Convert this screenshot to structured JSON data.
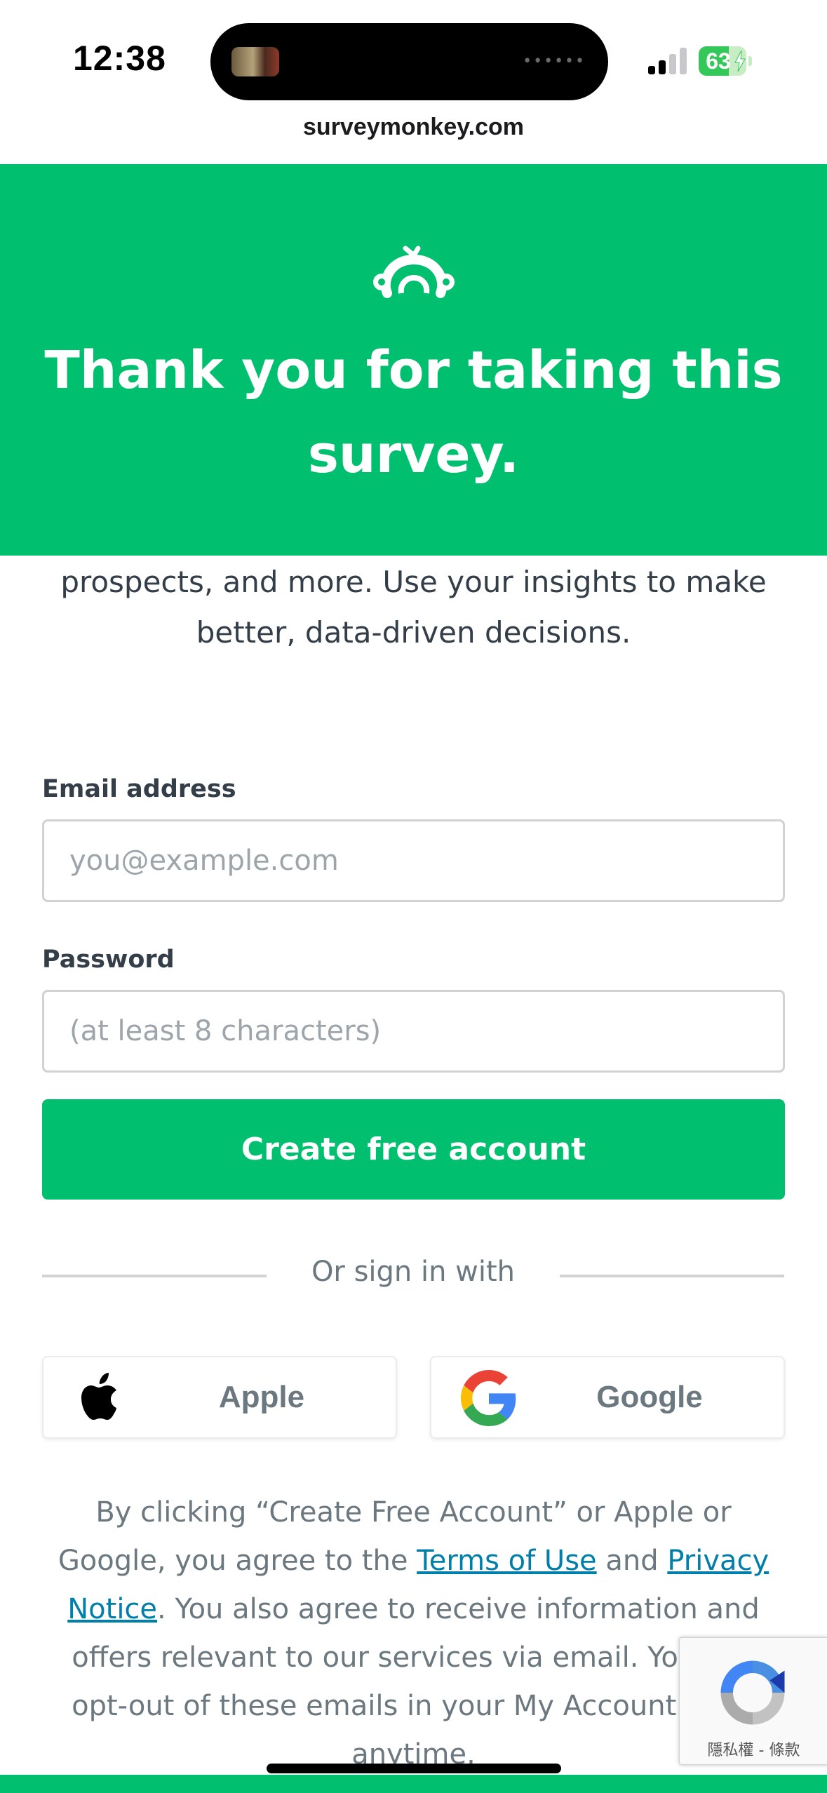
{
  "status_bar": {
    "time": "12:38",
    "battery_percent": "63",
    "battery_level": 0.63,
    "signal_bars_active": 2,
    "signal_bars_total": 4
  },
  "browser": {
    "url": "surveymonkey.com"
  },
  "hero": {
    "title": "Thank you for taking this survey.",
    "background_color": "#00bf6f"
  },
  "intro": {
    "text": "prospects, and more. Use your insights to make better, data-driven decisions."
  },
  "signup_form": {
    "email_label": "Email address",
    "email_placeholder": "you@example.com",
    "email_value": "",
    "password_label": "Password",
    "password_placeholder": "(at least 8 characters)",
    "password_value": "",
    "submit_label": "Create free account",
    "divider_text": "Or sign in with",
    "apple_label": "Apple",
    "google_label": "Google"
  },
  "legal": {
    "text_1": "By clicking “Create Free Account” or Apple or Google, you agree to the ",
    "terms_link": "Terms of Use",
    "text_2": " and ",
    "privacy_link": "Privacy Notice",
    "text_3": ". You also agree to receive information and offers relevant to our services via email. You can opt-out of these emails in your My Account page anytime."
  },
  "recaptcha": {
    "links": "隱私權 - 條款"
  },
  "icons": {
    "logo": "surveymonkey-logo-icon",
    "apple": "apple-logo-icon",
    "google": "google-logo-icon",
    "recaptcha": "recaptcha-logo-icon"
  },
  "colors": {
    "brand_green": "#00bf6f",
    "link_blue": "#007faa",
    "text_dark": "#333e48",
    "text_muted": "#6b787f"
  }
}
